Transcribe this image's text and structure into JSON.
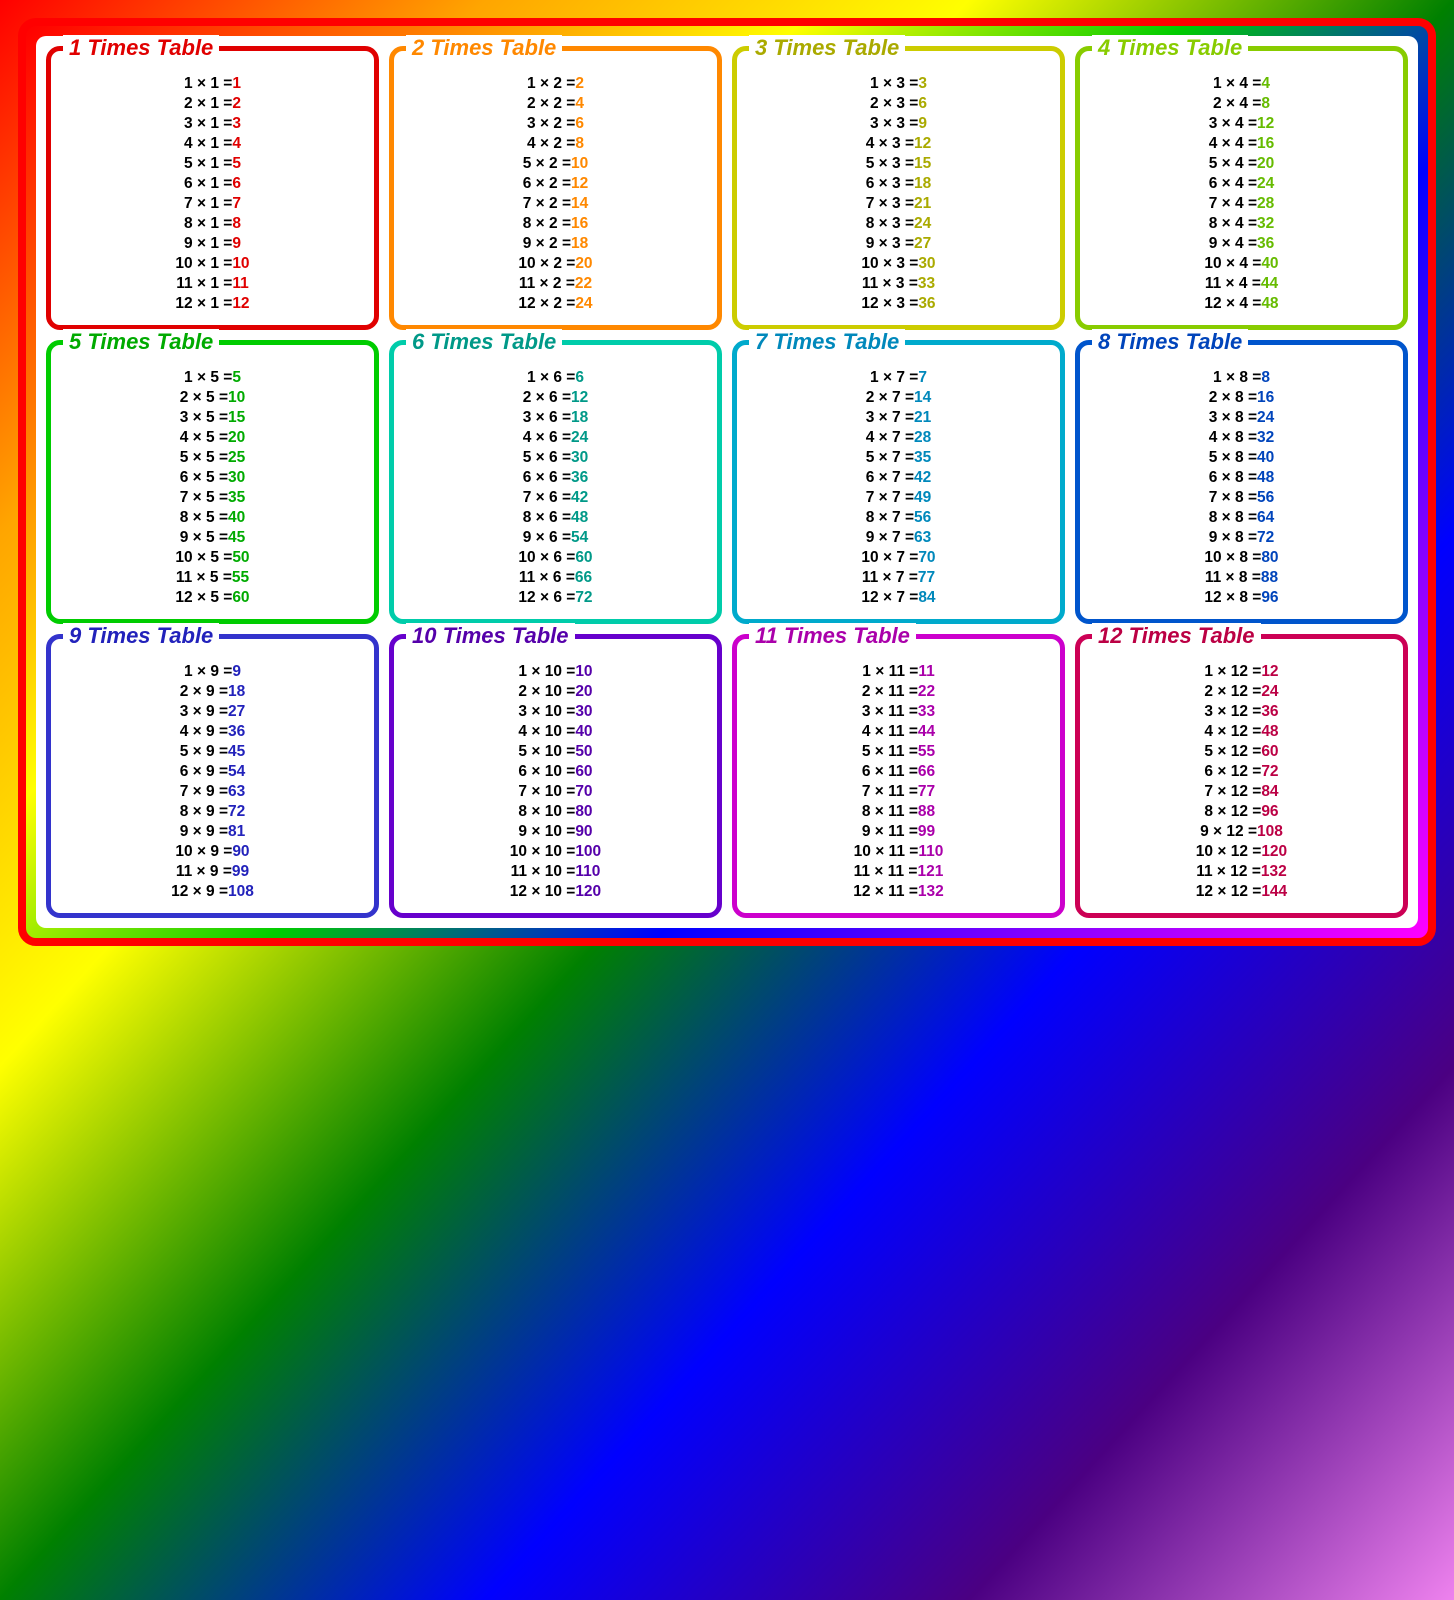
{
  "tables": [
    {
      "n": 1,
      "title": "1 Times Table",
      "borderClass": "card-1",
      "resultColor": "#e00000",
      "rows": [
        {
          "left": "1 × 1 =",
          "result": "1"
        },
        {
          "left": "2 × 1 =",
          "result": "2"
        },
        {
          "left": "3 × 1 =",
          "result": "3"
        },
        {
          "left": "4 × 1 =",
          "result": "4"
        },
        {
          "left": "5 × 1 =",
          "result": "5"
        },
        {
          "left": "6 × 1 =",
          "result": "6"
        },
        {
          "left": "7 × 1 =",
          "result": "7"
        },
        {
          "left": "8 × 1 =",
          "result": "8"
        },
        {
          "left": "9 × 1 =",
          "result": "9"
        },
        {
          "left": "10 × 1 =",
          "result": "10"
        },
        {
          "left": "11 × 1 =",
          "result": "11"
        },
        {
          "left": "12 × 1 =",
          "result": "12"
        }
      ]
    },
    {
      "n": 2,
      "title": "2 Times Table",
      "borderClass": "card-2",
      "resultColor": "#ff8800",
      "rows": [
        {
          "left": "1 × 2 =",
          "result": "2"
        },
        {
          "left": "2 × 2 =",
          "result": "4"
        },
        {
          "left": "3 × 2 =",
          "result": "6"
        },
        {
          "left": "4 × 2 =",
          "result": "8"
        },
        {
          "left": "5 × 2 =",
          "result": "10"
        },
        {
          "left": "6 × 2 =",
          "result": "12"
        },
        {
          "left": "7 × 2 =",
          "result": "14"
        },
        {
          "left": "8 × 2 =",
          "result": "16"
        },
        {
          "left": "9 × 2 =",
          "result": "18"
        },
        {
          "left": "10 × 2 =",
          "result": "20"
        },
        {
          "left": "11 × 2 =",
          "result": "22"
        },
        {
          "left": "12 × 2 =",
          "result": "24"
        }
      ]
    },
    {
      "n": 3,
      "title": "3 Times Table",
      "borderClass": "card-3",
      "resultColor": "#aaaa00",
      "rows": [
        {
          "left": "1 × 3 =",
          "result": "3"
        },
        {
          "left": "2 × 3 =",
          "result": "6"
        },
        {
          "left": "3 × 3 =",
          "result": "9"
        },
        {
          "left": "4 × 3 =",
          "result": "12"
        },
        {
          "left": "5 × 3 =",
          "result": "15"
        },
        {
          "left": "6 × 3 =",
          "result": "18"
        },
        {
          "left": "7 × 3 =",
          "result": "21"
        },
        {
          "left": "8 × 3 =",
          "result": "24"
        },
        {
          "left": "9 × 3 =",
          "result": "27"
        },
        {
          "left": "10 × 3 =",
          "result": "30"
        },
        {
          "left": "11 × 3 =",
          "result": "33"
        },
        {
          "left": "12 × 3 =",
          "result": "36"
        }
      ]
    },
    {
      "n": 4,
      "title": "4 Times Table",
      "borderClass": "card-4",
      "resultColor": "#66bb00",
      "rows": [
        {
          "left": "1 × 4 =",
          "result": "4"
        },
        {
          "left": "2 × 4 =",
          "result": "8"
        },
        {
          "left": "3 × 4 =",
          "result": "12"
        },
        {
          "left": "4 × 4 =",
          "result": "16"
        },
        {
          "left": "5 × 4 =",
          "result": "20"
        },
        {
          "left": "6 × 4 =",
          "result": "24"
        },
        {
          "left": "7 × 4 =",
          "result": "28"
        },
        {
          "left": "8 × 4 =",
          "result": "32"
        },
        {
          "left": "9 × 4 =",
          "result": "36"
        },
        {
          "left": "10 × 4 =",
          "result": "40"
        },
        {
          "left": "11 × 4 =",
          "result": "44"
        },
        {
          "left": "12 × 4 =",
          "result": "48"
        }
      ]
    },
    {
      "n": 5,
      "title": "5 Times Table",
      "borderClass": "card-5",
      "resultColor": "#00aa00",
      "rows": [
        {
          "left": "1 × 5 =",
          "result": "5"
        },
        {
          "left": "2 × 5 =",
          "result": "10"
        },
        {
          "left": "3 × 5 =",
          "result": "15"
        },
        {
          "left": "4 × 5 =",
          "result": "20"
        },
        {
          "left": "5 × 5 =",
          "result": "25"
        },
        {
          "left": "6 × 5 =",
          "result": "30"
        },
        {
          "left": "7 × 5 =",
          "result": "35"
        },
        {
          "left": "8 × 5 =",
          "result": "40"
        },
        {
          "left": "9 × 5 =",
          "result": "45"
        },
        {
          "left": "10 × 5 =",
          "result": "50"
        },
        {
          "left": "11 × 5 =",
          "result": "55"
        },
        {
          "left": "12 × 5 =",
          "result": "60"
        }
      ]
    },
    {
      "n": 6,
      "title": "6 Times Table",
      "borderClass": "card-6",
      "resultColor": "#009988",
      "rows": [
        {
          "left": "1 × 6 =",
          "result": "6"
        },
        {
          "left": "2 × 6 =",
          "result": "12"
        },
        {
          "left": "3 × 6 =",
          "result": "18"
        },
        {
          "left": "4 × 6 =",
          "result": "24"
        },
        {
          "left": "5 × 6 =",
          "result": "30"
        },
        {
          "left": "6 × 6 =",
          "result": "36"
        },
        {
          "left": "7 × 6 =",
          "result": "42"
        },
        {
          "left": "8 × 6 =",
          "result": "48"
        },
        {
          "left": "9 × 6 =",
          "result": "54"
        },
        {
          "left": "10 × 6 =",
          "result": "60"
        },
        {
          "left": "11 × 6 =",
          "result": "66"
        },
        {
          "left": "12 × 6 =",
          "result": "72"
        }
      ]
    },
    {
      "n": 7,
      "title": "7 Times Table",
      "borderClass": "card-7",
      "resultColor": "#0088bb",
      "rows": [
        {
          "left": "1 × 7 =",
          "result": "7"
        },
        {
          "left": "2 × 7 =",
          "result": "14"
        },
        {
          "left": "3 × 7 =",
          "result": "21"
        },
        {
          "left": "4 × 7 =",
          "result": "28"
        },
        {
          "left": "5 × 7 =",
          "result": "35"
        },
        {
          "left": "6 × 7 =",
          "result": "42"
        },
        {
          "left": "7 × 7 =",
          "result": "49"
        },
        {
          "left": "8 × 7 =",
          "result": "56"
        },
        {
          "left": "9 × 7 =",
          "result": "63"
        },
        {
          "left": "10 × 7 =",
          "result": "70"
        },
        {
          "left": "11 × 7 =",
          "result": "77"
        },
        {
          "left": "12 × 7 =",
          "result": "84"
        }
      ]
    },
    {
      "n": 8,
      "title": "8 Times Table",
      "borderClass": "card-8",
      "resultColor": "#0044bb",
      "rows": [
        {
          "left": "1 × 8 =",
          "result": "8"
        },
        {
          "left": "2 × 8 =",
          "result": "16"
        },
        {
          "left": "3 × 8 =",
          "result": "24"
        },
        {
          "left": "4 × 8 =",
          "result": "32"
        },
        {
          "left": "5 × 8 =",
          "result": "40"
        },
        {
          "left": "6 × 8 =",
          "result": "48"
        },
        {
          "left": "7 × 8 =",
          "result": "56"
        },
        {
          "left": "8 × 8 =",
          "result": "64"
        },
        {
          "left": "9 × 8 =",
          "result": "72"
        },
        {
          "left": "10 × 8 =",
          "result": "80"
        },
        {
          "left": "11 × 8 =",
          "result": "88"
        },
        {
          "left": "12 × 8 =",
          "result": "96"
        }
      ]
    },
    {
      "n": 9,
      "title": "9 Times Table",
      "borderClass": "card-9",
      "resultColor": "#2222bb",
      "rows": [
        {
          "left": "1 × 9 =",
          "result": "9"
        },
        {
          "left": "2 × 9 =",
          "result": "18"
        },
        {
          "left": "3 × 9 =",
          "result": "27"
        },
        {
          "left": "4 × 9 =",
          "result": "36"
        },
        {
          "left": "5 × 9 =",
          "result": "45"
        },
        {
          "left": "6 × 9 =",
          "result": "54"
        },
        {
          "left": "7 × 9 =",
          "result": "63"
        },
        {
          "left": "8 × 9 =",
          "result": "72"
        },
        {
          "left": "9 × 9 =",
          "result": "81"
        },
        {
          "left": "10 × 9 =",
          "result": "90"
        },
        {
          "left": "11 × 9 =",
          "result": "99"
        },
        {
          "left": "12 × 9 =",
          "result": "108"
        }
      ]
    },
    {
      "n": 10,
      "title": "10 Times Table",
      "borderClass": "card-10",
      "resultColor": "#5500aa",
      "rows": [
        {
          "left": "1 × 10 =",
          "result": "10"
        },
        {
          "left": "2 × 10 =",
          "result": "20"
        },
        {
          "left": "3 × 10 =",
          "result": "30"
        },
        {
          "left": "4 × 10 =",
          "result": "40"
        },
        {
          "left": "5 × 10 =",
          "result": "50"
        },
        {
          "left": "6 × 10 =",
          "result": "60"
        },
        {
          "left": "7 × 10 =",
          "result": "70"
        },
        {
          "left": "8 × 10 =",
          "result": "80"
        },
        {
          "left": "9 × 10 =",
          "result": "90"
        },
        {
          "left": "10 × 10 =",
          "result": "100"
        },
        {
          "left": "11 × 10 =",
          "result": "110"
        },
        {
          "left": "12 × 10 =",
          "result": "120"
        }
      ]
    },
    {
      "n": 11,
      "title": "11 Times Table",
      "borderClass": "card-11",
      "resultColor": "#aa00aa",
      "rows": [
        {
          "left": "1 × 11 =",
          "result": "11"
        },
        {
          "left": "2 × 11 =",
          "result": "22"
        },
        {
          "left": "3 × 11 =",
          "result": "33"
        },
        {
          "left": "4 × 11 =",
          "result": "44"
        },
        {
          "left": "5 × 11 =",
          "result": "55"
        },
        {
          "left": "6 × 11 =",
          "result": "66"
        },
        {
          "left": "7 × 11 =",
          "result": "77"
        },
        {
          "left": "8 × 11 =",
          "result": "88"
        },
        {
          "left": "9 × 11 =",
          "result": "99"
        },
        {
          "left": "10 × 11 =",
          "result": "110"
        },
        {
          "left": "11 × 11 =",
          "result": "121"
        },
        {
          "left": "12 × 11 =",
          "result": "132"
        }
      ]
    },
    {
      "n": 12,
      "title": "12 Times Table",
      "borderClass": "card-12",
      "resultColor": "#bb0044",
      "rows": [
        {
          "left": "1 × 12 =",
          "result": "12"
        },
        {
          "left": "2 × 12 =",
          "result": "24"
        },
        {
          "left": "3 × 12 =",
          "result": "36"
        },
        {
          "left": "4 × 12 =",
          "result": "48"
        },
        {
          "left": "5 × 12 =",
          "result": "60"
        },
        {
          "left": "6 × 12 =",
          "result": "72"
        },
        {
          "left": "7 × 12 =",
          "result": "84"
        },
        {
          "left": "8 × 12 =",
          "result": "96"
        },
        {
          "left": "9 × 12 =",
          "result": "108"
        },
        {
          "left": "10 × 12 =",
          "result": "120"
        },
        {
          "left": "11 × 12 =",
          "result": "132"
        },
        {
          "left": "12 × 12 =",
          "result": "144"
        }
      ]
    }
  ]
}
